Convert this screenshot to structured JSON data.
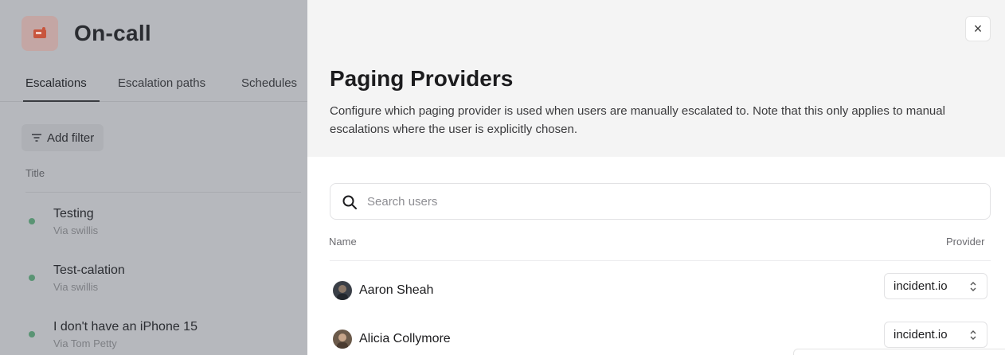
{
  "background_page": {
    "title": "On-call",
    "tabs": [
      {
        "label": "Escalations",
        "active": true
      },
      {
        "label": "Escalation paths",
        "active": false
      },
      {
        "label": "Schedules",
        "active": false
      }
    ],
    "filter_label": "Add filter",
    "column_title": "Title",
    "escalations": [
      {
        "title": "Testing",
        "subtitle": "Via swillis",
        "status_color": "#5a9474"
      },
      {
        "title": "Test-calation",
        "subtitle": "Via swillis",
        "status_color": "#5a9474"
      },
      {
        "title": "I don't have an iPhone 15",
        "subtitle": "Via Tom Petty",
        "status_color": "#5a9474"
      }
    ]
  },
  "drawer": {
    "close_label": "×",
    "title": "Paging Providers",
    "description": "Configure which paging provider is used when users are manually escalated to. Note that this only applies to manual escalations where the user is explicitly chosen.",
    "search": {
      "placeholder": "Search users",
      "value": ""
    },
    "columns": {
      "name": "Name",
      "provider": "Provider"
    },
    "users": [
      {
        "name": "Aaron Sheah",
        "provider": "incident.io"
      },
      {
        "name": "Alicia Collymore",
        "provider": "incident.io"
      }
    ]
  },
  "icons": {
    "app": "pager-icon",
    "filter": "filter-icon",
    "search": "search-icon",
    "close": "close-icon",
    "select": "chevron-up-down-icon"
  },
  "colors": {
    "status_active": "#5a9474",
    "overlay": "#b6b8bd",
    "drawer_header": "#f4f4f4"
  }
}
